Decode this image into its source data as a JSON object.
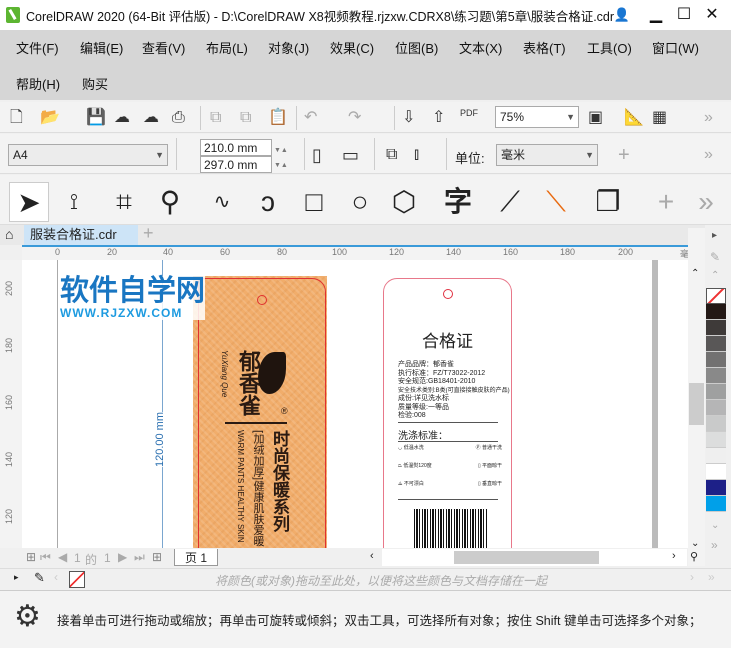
{
  "window": {
    "title": "CorelDRAW 2020 (64-Bit 评估版) - D:\\CorelDRAW X8视频教程.rjzxw.CDRX8\\练习题\\第5章\\服装合格证.cdr",
    "minimize": "▁",
    "maximize": "☐",
    "close": "✕"
  },
  "menu": [
    "文件(F)",
    "编辑(E)",
    "查看(V)",
    "布局(L)",
    "对象(J)",
    "效果(C)",
    "位图(B)",
    "文本(X)",
    "表格(T)",
    "工具(O)",
    "窗口(W)",
    "帮助(H)",
    "购买"
  ],
  "standard_toolbar": {
    "zoom": "75%",
    "pdf_label": "PDF"
  },
  "property_bar": {
    "page_size": "A4",
    "width": "210.0 mm",
    "height": "297.0 mm",
    "units_label": "单位:",
    "units": "毫米"
  },
  "toolbox": {
    "text_tool_glyph": "字"
  },
  "document_tab": {
    "name": "服装合格证.cdr"
  },
  "ruler_top": {
    "ticks": [
      "0",
      "20",
      "40",
      "60",
      "80",
      "100",
      "120",
      "140",
      "160",
      "180",
      "200"
    ],
    "unit": "毫米"
  },
  "ruler_left": {
    "ticks": [
      "200",
      "180",
      "160",
      "140",
      "120"
    ]
  },
  "canvas": {
    "watermark": {
      "title": "软件自学网",
      "url": "WWW.RJZXW.COM"
    },
    "dimension": "120.00 mm",
    "orange_tag": {
      "brand": "郁香雀",
      "brand_pinyin": "YuXiang Que",
      "series": "时尚保暖系列",
      "sub": "[加绒加厚]健康肌肤爱暖",
      "english": "WARM PANTS HEALTHY SKIN",
      "registered": "®"
    },
    "white_tag": {
      "title": "合格证",
      "lines": [
        "产品品牌：郁香雀",
        "执行标准：FZ/T73022-2012",
        "安全规范:GB18401-2010",
        "安全技术类别:B类(可直接接触皮肤的产品)",
        "成份:详见洗水标",
        "质量等级:一等品",
        "检验:008"
      ],
      "wash_title": "洗涤标准：",
      "wash": [
        [
          "低温水洗",
          "普通干洗"
        ],
        [
          "低温熨120度",
          "平面晾干"
        ],
        [
          "不可漂白",
          "垂直晾干"
        ]
      ]
    }
  },
  "page_nav": {
    "current": "1",
    "of": "的",
    "total": "1",
    "page_tab": "页 1"
  },
  "color_well_hint": "将颜色(或对象)拖动至此处，以便将这些颜色与文档存储在一起",
  "palette": [
    "#231815",
    "#3e3a39",
    "#595757",
    "#727171",
    "#898989",
    "#9fa0a0",
    "#b5b5b6",
    "#c9caca",
    "#dcdddd",
    "#efefef",
    "#ffffff",
    "#1d2088",
    "#00a0e9"
  ],
  "status": "接着单击可进行拖动或缩放；再单击可旋转或倾斜；双击工具，可选择所有对象；按住 Shift 键单击可选择多个对象；"
}
